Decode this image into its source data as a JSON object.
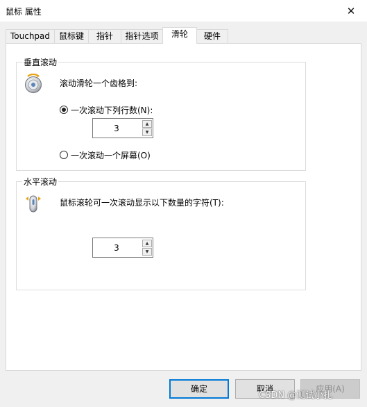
{
  "window": {
    "title": "鼠标 属性",
    "close_glyph": "✕"
  },
  "tabs": [
    {
      "label": "Touchpad",
      "active": false
    },
    {
      "label": "鼠标键",
      "active": false
    },
    {
      "label": "指针",
      "active": false
    },
    {
      "label": "指针选项",
      "active": false
    },
    {
      "label": "滑轮",
      "active": true
    },
    {
      "label": "硬件",
      "active": false
    }
  ],
  "vertical_scroll": {
    "group_title": "垂直滚动",
    "instruction": "滚动滑轮一个齿格到:",
    "option_lines_label": "一次滚动下列行数(N):",
    "option_lines_selected": true,
    "lines_value": "3",
    "option_screen_label": "一次滚动一个屏幕(O)",
    "option_screen_selected": false,
    "icon": "mouse-wheel-icon"
  },
  "horizontal_scroll": {
    "group_title": "水平滚动",
    "instruction": "鼠标滚轮可一次滚动显示以下数量的字符(T):",
    "chars_value": "3",
    "icon": "mouse-wheel-icon"
  },
  "buttons": {
    "ok": "确定",
    "cancel": "取消",
    "apply": "应用(A)"
  },
  "watermark": "CSDN @测试小扎",
  "colors": {
    "accent": "#0078d7",
    "background": "#f0f0f0",
    "panel": "#ffffff"
  }
}
